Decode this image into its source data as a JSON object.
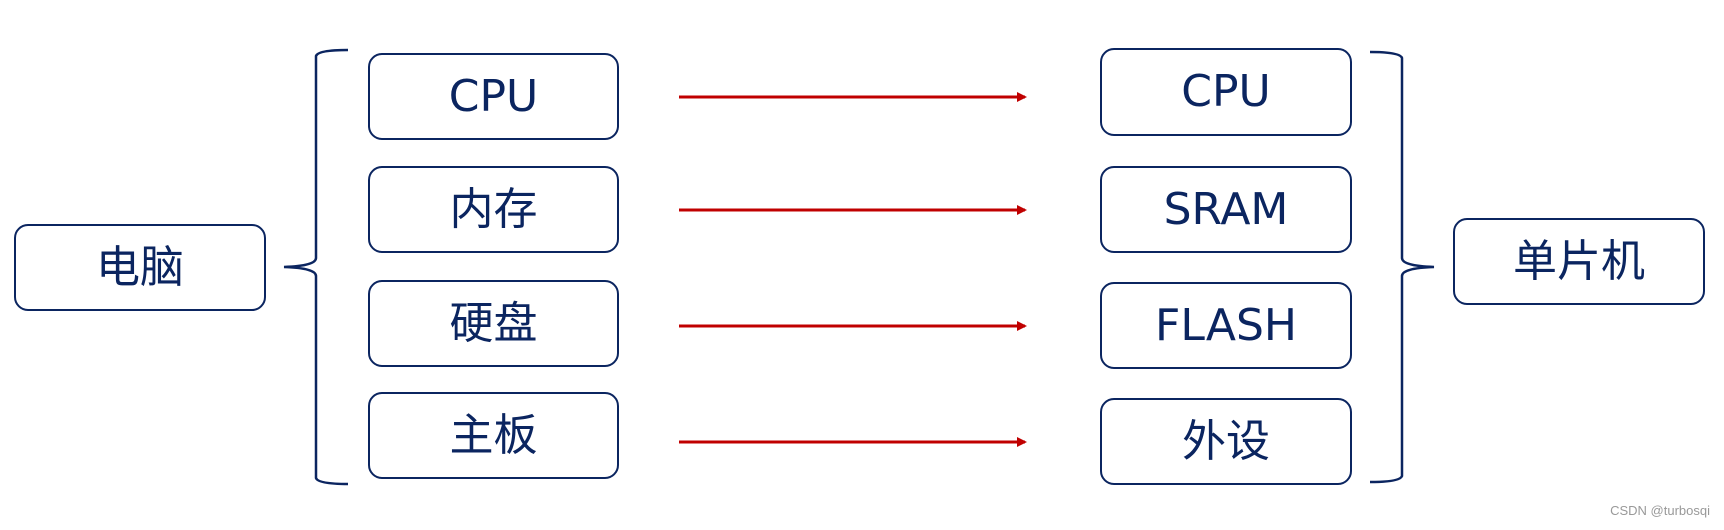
{
  "diagram": {
    "left_root": "电脑",
    "right_root": "单片机",
    "left_items": [
      "CPU",
      "内存",
      "硬盘",
      "主板"
    ],
    "right_items": [
      "CPU",
      "SRAM",
      "FLASH",
      "外设"
    ],
    "relation": "maps-to",
    "colors": {
      "box_border": "#0b2560",
      "text": "#0b2560",
      "arrow": "#c00000"
    }
  },
  "watermark": "CSDN @turbosqi"
}
